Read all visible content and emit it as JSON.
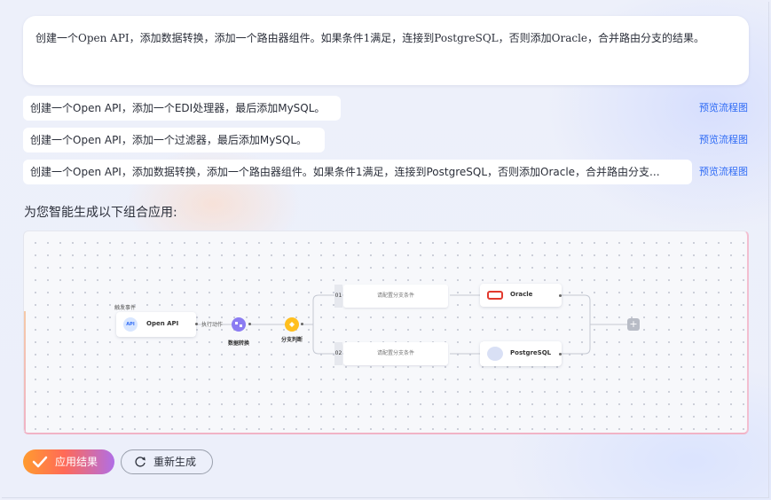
{
  "prompt": {
    "text": "创建一个Open API，添加数据转换，添加一个路由器组件。如果条件1满足，连接到PostgreSQL，否则添加Oracle，合并路由分支的结果。"
  },
  "suggestions": [
    {
      "text": "创建一个Open API，添加一个EDI处理器，最后添加MySQL。",
      "action": "预览流程图"
    },
    {
      "text": "创建一个Open API，添加一个过滤器，最后添加MySQL。",
      "action": "预览流程图"
    },
    {
      "text": "创建一个Open API，添加数据转换，添加一个路由器组件。如果条件1满足，连接到PostgreSQL，否则添加Oracle，合并路由分支...",
      "action": "预览流程图"
    }
  ],
  "section_title": "为您智能生成以下组合应用:",
  "flow": {
    "trigger_label": "触发事件",
    "open_api": "Open API",
    "api_badge": "API",
    "exec_label": "执行动作",
    "transform": "数据转换",
    "branch": "分支判断",
    "branches": [
      {
        "index": "01",
        "condition": "请配置分支条件",
        "target": "Oracle"
      },
      {
        "index": "02",
        "condition": "请配置分支条件",
        "target": "PostgreSQL"
      }
    ],
    "add_symbol": "+"
  },
  "buttons": {
    "apply": "应用结果",
    "regenerate": "重新生成"
  },
  "colors": {
    "link": "#2f6bf5",
    "apply_gradient": [
      "#ff9b2f",
      "#ff6a57",
      "#b06ee6"
    ],
    "transform_node": "#8b7cf2",
    "branch_node": "#ffbf1f",
    "oracle_red": "#e23a2e"
  }
}
